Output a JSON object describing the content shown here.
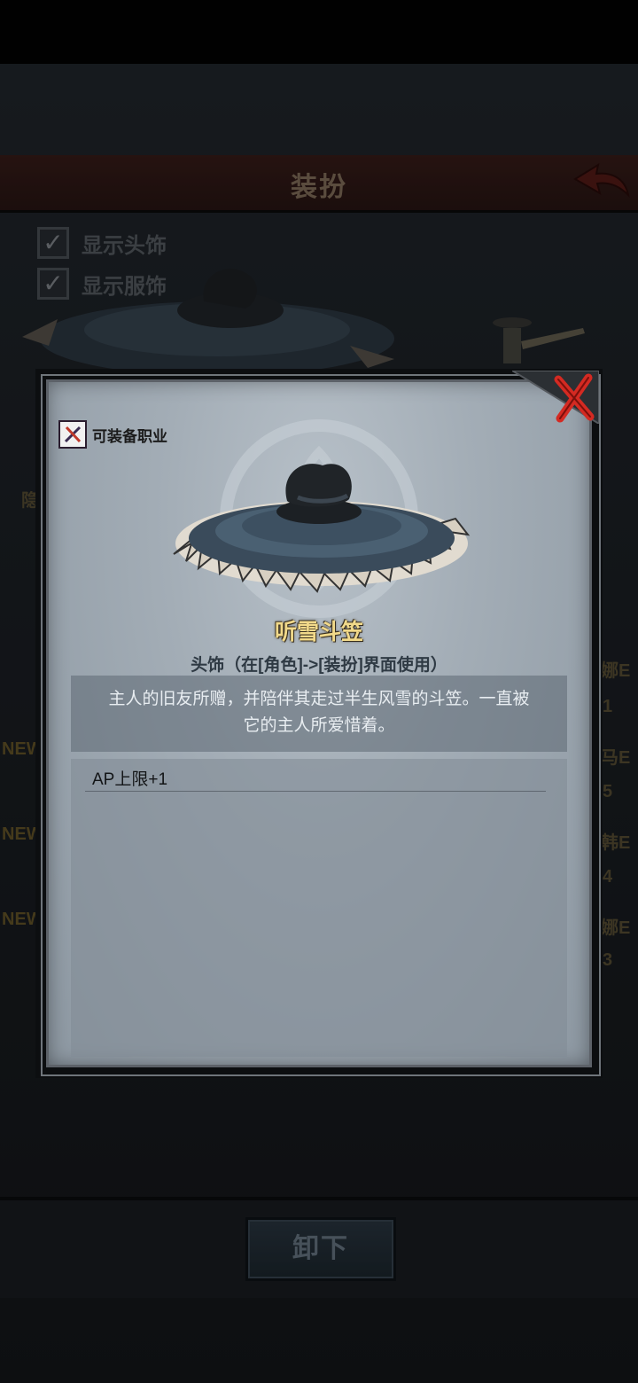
{
  "background": {
    "header_title": "装扮",
    "show_headwear_label": "显示头饰",
    "show_clothing_label": "显示服饰",
    "side_tab_label": "隐",
    "side_labels": [
      "娜E",
      "1",
      "马E",
      "5",
      "韩E",
      "4",
      "娜E",
      "3"
    ],
    "new_badges": [
      "NEW",
      "NEW",
      "NEW"
    ]
  },
  "modal": {
    "job_tag_label": "可装备职业",
    "item_name": "听雪斗笠",
    "item_type": "头饰（在[角色]->[装扮]界面使用）",
    "description_line1": "主人的旧友所赠，并陪伴其走过半生风雪的斗笠。一直被",
    "description_line2": "它的主人所爱惜着。",
    "stats": [
      "AP上限+1"
    ]
  },
  "actions": {
    "unequip_label": "卸下"
  },
  "colors": {
    "item_name": "#f1d98a",
    "close_red": "#d42a22",
    "header_red": "#3b1e1a"
  }
}
